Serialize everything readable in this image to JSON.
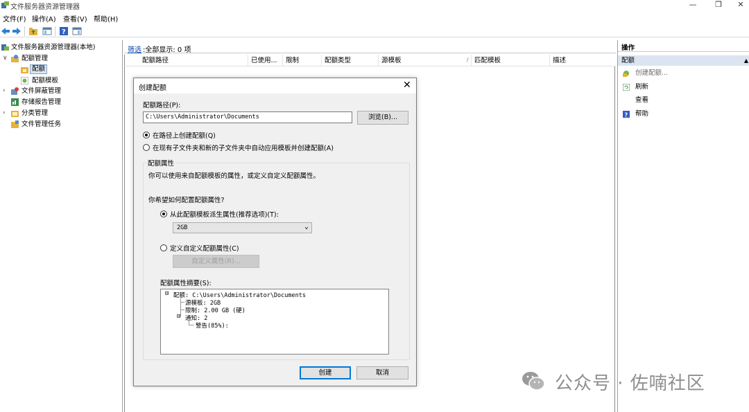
{
  "window": {
    "title": "文件服务器资源管理器",
    "controls": {
      "minimize": "—",
      "maximize": "❐",
      "close": "✕"
    }
  },
  "menu": [
    "文件(F)",
    "操作(A)",
    "查看(V)",
    "帮助(H)"
  ],
  "toolbar": {
    "icons": [
      "back-arrow-icon",
      "forward-arrow-icon",
      "folder-up-icon",
      "show-hide-tree-icon",
      "help-icon",
      "properties-icon"
    ]
  },
  "tree": {
    "root": "文件服务器资源管理器(本地)",
    "items": [
      {
        "label": "配额管理",
        "expanded": true
      },
      {
        "label": "配额",
        "selected": true
      },
      {
        "label": "配额模板"
      },
      {
        "label": "文件屏蔽管理",
        "expanded": false
      },
      {
        "label": "存储报告管理"
      },
      {
        "label": "分类管理",
        "expanded": false
      },
      {
        "label": "文件管理任务"
      }
    ]
  },
  "center": {
    "filter_link": "筛选",
    "filter_text": ":全部显示: 0 项",
    "columns": [
      "配额路径",
      "已使用...",
      "限制",
      "配额类型",
      "源模板",
      "匹配模板",
      "描述"
    ],
    "sort_indicator": "/"
  },
  "dialog": {
    "title": "创建配额",
    "close": "✕",
    "path_label": "配额路径(P):",
    "path_value": "C:\\Users\\Administrator\\Documents",
    "browse_button": "浏览(B)...",
    "radio_create_on_path": "在路径上创建配额(Q)",
    "radio_auto_apply": "在现有子文件夹和新的子文件夹中自动应用模板并创建配额(A)",
    "group_title": "配额属性",
    "group_desc": "你可以使用来自配额模板的属性，或定义自定义配额属性。",
    "question": "你希望如何配置配额属性?",
    "radio_derive": "从此配额模板派生属性(推荐选项)(T):",
    "template_selected": "2GB",
    "radio_custom": "定义自定义配额属性(C)",
    "custom_button": "自定义属性(R)...",
    "summary_label": "配额属性摘要(S):",
    "summary": {
      "root": "配额: C:\\Users\\Administrator\\Documents",
      "source_template": "源模板: 2GB",
      "limit": "限制: 2.00 GB (硬)",
      "notify": "通知: 2",
      "warning": "警告(85%):",
      "root_toggle": "⊟",
      "notify_toggle": "⊟"
    },
    "create_button": "创建",
    "cancel_button": "取消"
  },
  "actions": {
    "header": "操作",
    "section": "配额",
    "collapse": "▲",
    "items": [
      "创建配额...",
      "刷新",
      "查看",
      "帮助"
    ]
  },
  "watermark": {
    "text": "公众号 · 佐喃社区"
  },
  "colors": {
    "selection": "#dbe5f1",
    "link": "#0645ad",
    "dialog_bg": "#f0f0f0",
    "default_button_border": "#0078d7"
  }
}
